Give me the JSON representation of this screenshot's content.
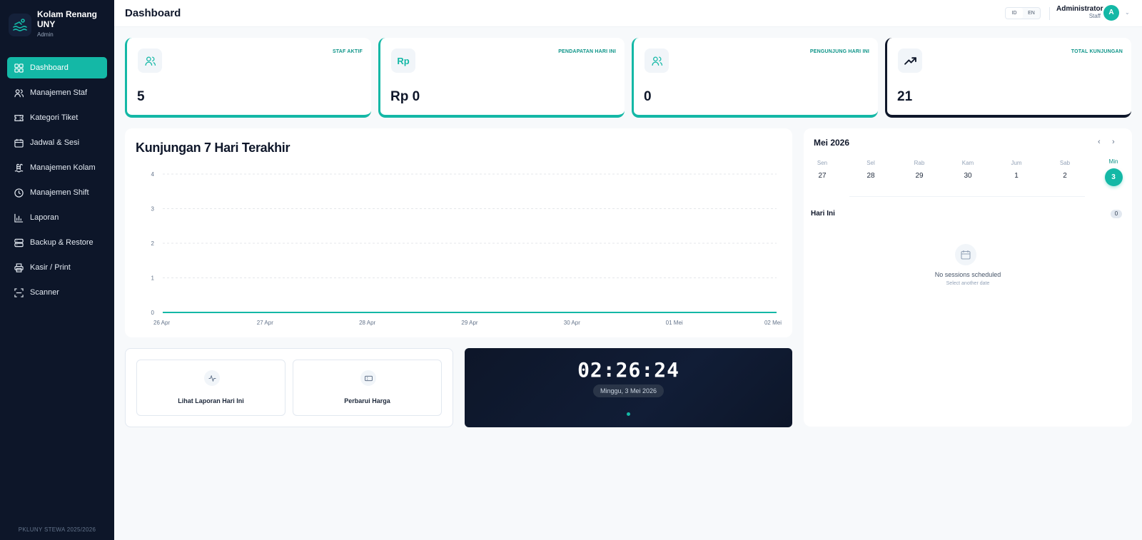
{
  "brand": {
    "title": "Kolam Renang UNY",
    "role": "Admin"
  },
  "sidebar": {
    "items": [
      {
        "label": "Dashboard",
        "icon": "dashboard-icon"
      },
      {
        "label": "Manajemen Staf",
        "icon": "users-icon"
      },
      {
        "label": "Kategori Tiket",
        "icon": "ticket-icon"
      },
      {
        "label": "Jadwal & Sesi",
        "icon": "calendar-icon"
      },
      {
        "label": "Manajemen Kolam",
        "icon": "pool-icon"
      },
      {
        "label": "Manajemen Shift",
        "icon": "clock-icon"
      },
      {
        "label": "Laporan",
        "icon": "bar-chart-icon"
      },
      {
        "label": "Backup & Restore",
        "icon": "database-icon"
      },
      {
        "label": "Kasir / Print",
        "icon": "printer-icon"
      },
      {
        "label": "Scanner",
        "icon": "scan-icon"
      }
    ],
    "footer": "PKLUNY STEWA 2025/2026"
  },
  "header": {
    "title": "Dashboard",
    "lang": {
      "id": "ID",
      "en": "EN",
      "selected": "ID"
    },
    "user": {
      "name": "Administrator",
      "role": "Staff",
      "initial": "A"
    }
  },
  "stats": [
    {
      "label": "STAF AKTIF",
      "value": "5",
      "icon": "users-icon"
    },
    {
      "label": "PENDAPATAN HARI INI",
      "value": "Rp 0",
      "icon": "rupiah-icon",
      "icon_text": "Rp"
    },
    {
      "label": "PENGUNJUNG HARI INI",
      "value": "0",
      "icon": "users-icon"
    },
    {
      "label": "TOTAL KUNJUNGAN",
      "value": "21",
      "icon": "trending-up-icon"
    }
  ],
  "chart_data": {
    "type": "line",
    "title": "Kunjungan 7 Hari Terakhir",
    "categories": [
      "26 Apr",
      "27 Apr",
      "28 Apr",
      "29 Apr",
      "30 Apr",
      "01 Mei",
      "02 Mei"
    ],
    "values": [
      0,
      0,
      0,
      0,
      0,
      0,
      0
    ],
    "y_ticks": [
      0,
      1,
      2,
      3,
      4
    ],
    "ylim": [
      0,
      4
    ],
    "grid": true,
    "color": "#14b8a6"
  },
  "actions": [
    {
      "label": "Lihat Laporan Hari Ini",
      "icon": "activity-icon"
    },
    {
      "label": "Perbarui Harga",
      "icon": "ticket-icon"
    }
  ],
  "clock": {
    "time": "02:26:24",
    "date": "Minggu, 3 Mei 2026"
  },
  "calendar": {
    "month": "Mei 2026",
    "prev": "‹",
    "next": "›",
    "days": [
      {
        "name": "Sen",
        "num": "27"
      },
      {
        "name": "Sel",
        "num": "28"
      },
      {
        "name": "Rab",
        "num": "29"
      },
      {
        "name": "Kam",
        "num": "30"
      },
      {
        "name": "Jum",
        "num": "1"
      },
      {
        "name": "Sab",
        "num": "2"
      },
      {
        "name": "Min",
        "num": "3",
        "today": true
      }
    ],
    "today_label": "Hari Ini",
    "today_count": "0",
    "empty_title": "No sessions scheduled",
    "empty_sub": "Select another date"
  },
  "colors": {
    "accent": "#14b8a6",
    "sidebar": "#0d1629",
    "dark": "#0f172a"
  }
}
